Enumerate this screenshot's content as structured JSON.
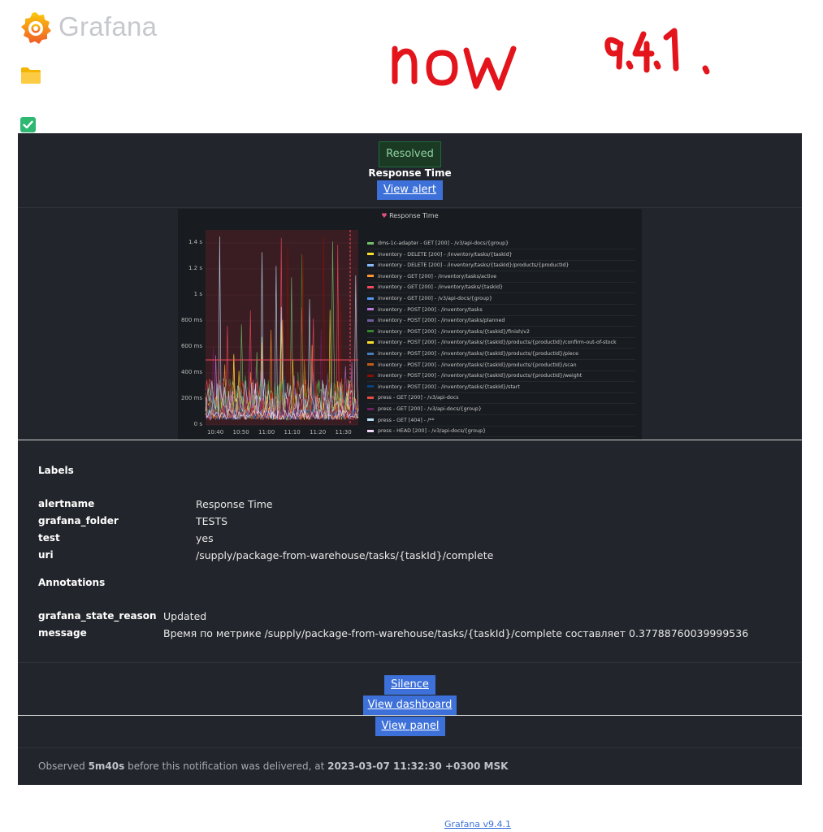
{
  "branding": {
    "logo_text": "Grafana",
    "handwritten_note": "now",
    "handwritten_version": "9.4.1."
  },
  "alert": {
    "status": "Resolved",
    "name": "Response Time",
    "view_alert_label": "View alert"
  },
  "panel": {
    "title": "Response Time",
    "icon": "broken-heart-icon"
  },
  "chart_data": {
    "type": "line",
    "title": "Response Time",
    "y_ticks": [
      "1.4 s",
      "1.2 s",
      "1 s",
      "800 ms",
      "600 ms",
      "400 ms",
      "200 ms",
      "0 s"
    ],
    "x_ticks": [
      "10:40",
      "10:50",
      "11:00",
      "11:10",
      "11:20",
      "11:30"
    ],
    "ylim": [
      0,
      1.5
    ],
    "threshold": 0.5,
    "alert_time": "11:32",
    "series": [
      {
        "name": "dms-1c-adapter - GET [200] - /v3/api-docs/{group}",
        "color": "#73bf69"
      },
      {
        "name": "inventory - DELETE [200] - /inventory/tasks/{taskId}",
        "color": "#fade2a"
      },
      {
        "name": "inventory - DELETE [200] - /inventory/tasks/{taskId}/products/{productId}",
        "color": "#8ab8ff"
      },
      {
        "name": "inventory - GET [200] - /inventory/tasks/active",
        "color": "#ff9830"
      },
      {
        "name": "inventory - GET [200] - /inventory/tasks/{taskId}",
        "color": "#f2495c"
      },
      {
        "name": "inventory - GET [200] - /v3/api-docs/{group}",
        "color": "#5794f2"
      },
      {
        "name": "inventory - POST [200] - /inventory/tasks",
        "color": "#b877d9"
      },
      {
        "name": "inventory - POST [200] - /inventory/tasks/planned",
        "color": "#705da0"
      },
      {
        "name": "inventory - POST [200] - /inventory/tasks/{taskId}/finish/v2",
        "color": "#37872d"
      },
      {
        "name": "inventory - POST [200] - /inventory/tasks/{taskId}/products/{productId}/confirm-out-of-stock",
        "color": "#fade2a"
      },
      {
        "name": "inventory - POST [200] - /inventory/tasks/{taskId}/products/{productId}/piece",
        "color": "#447ebc"
      },
      {
        "name": "inventory - POST [200] - /inventory/tasks/{taskId}/products/{productId}/scan",
        "color": "#c15c17"
      },
      {
        "name": "inventory - POST [200] - /inventory/tasks/{taskId}/products/{productId}/weight",
        "color": "#890f02"
      },
      {
        "name": "inventory - POST [200] - /inventory/tasks/{taskId}/start",
        "color": "#0a437c"
      },
      {
        "name": "press - GET [200] - /v3/api-docs",
        "color": "#e24d42"
      },
      {
        "name": "press - GET [200] - /v3/api-docs/{group}",
        "color": "#6d1f62"
      },
      {
        "name": "press - GET [404] - /**",
        "color": "#badff4"
      },
      {
        "name": "press - HEAD [200] - /v3/api-docs/{group}",
        "color": "#f9d9f9"
      }
    ]
  },
  "labels": {
    "title": "Labels",
    "items": [
      {
        "key": "alertname",
        "value": "Response Time"
      },
      {
        "key": "grafana_folder",
        "value": "TESTS"
      },
      {
        "key": "test",
        "value": "yes"
      },
      {
        "key": "uri",
        "value": "/supply/package-from-warehouse/tasks/{taskId}/complete"
      }
    ]
  },
  "annotations": {
    "title": "Annotations",
    "items": [
      {
        "key": "grafana_state_reason",
        "value": "Updated"
      },
      {
        "key": "message",
        "value": "Время по метрике /supply/package-from-warehouse/tasks/{taskId}/complete составляет 0.37788760039999536"
      }
    ]
  },
  "actions": {
    "silence": "Silence",
    "view_dashboard": "View dashboard",
    "view_panel": "View panel"
  },
  "footer": {
    "observed_prefix": "Observed",
    "observed_duration": "5m40s",
    "observed_middle": "before this notification was delivered, at",
    "observed_time": "2023-03-07 11:32:30 +0300 MSK",
    "version_link": "Grafana v9.4.1"
  },
  "colors": {
    "card_bg": "#22252b",
    "button": "#3d71d9",
    "resolved_green": "#8fd3a0"
  }
}
